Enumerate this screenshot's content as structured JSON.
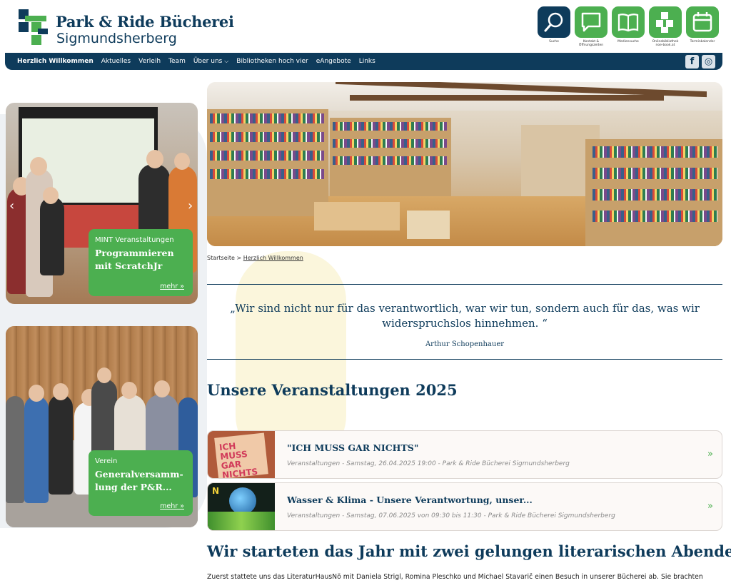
{
  "header": {
    "brand_line1": "Park & Ride Bücherei",
    "brand_line2": "Sigmundsherberg",
    "icon_links": [
      {
        "label": "Suche",
        "icon": "search-icon"
      },
      {
        "label": "Kontakt & Öffnungszeiten",
        "icon": "chat-icon"
      },
      {
        "label": "Mediensuche",
        "icon": "book-icon"
      },
      {
        "label": "Onlinebibliothek noe-book.at",
        "icon": "building-icon"
      },
      {
        "label": "Terminkalender",
        "icon": "calendar-icon"
      }
    ]
  },
  "nav": {
    "items": [
      "Herzlich Willkommen",
      "Aktuelles",
      "Verleih",
      "Team",
      "Über uns",
      "Bibliotheken hoch vier",
      "eAngebote",
      "Links"
    ],
    "dropdown_item_index": 4,
    "social": {
      "facebook": "f",
      "instagram": "◎"
    }
  },
  "sidebar": {
    "cards": [
      {
        "category": "MINT Veranstaltungen",
        "title": "Programmieren mit ScratchJr",
        "more": "mehr »"
      },
      {
        "category": "Verein",
        "title": "Generalversamm-lung der P&R...",
        "more": "mehr »"
      }
    ]
  },
  "breadcrumb": {
    "root": "Startseite",
    "separator": ">",
    "current": "Herzlich Willkommen"
  },
  "quote": {
    "text": "„Wir sind nicht nur für das verantwortlich, war wir tun, sondern auch für das, was wir widerspruchslos hinnehmen. “",
    "author": "Arthur Schopenhauer"
  },
  "events": {
    "heading": "Unsere Veranstaltungen 2025",
    "items": [
      {
        "title": "\"ICH MUSS GAR NICHTS\"",
        "meta": "Veranstaltungen - Samstag, 26.04.2025 19:00 - Park & Ride Bücherei Sigmundsherberg",
        "thumb_text": "ICH MUSS GAR NICHTS"
      },
      {
        "title": "Wasser & Klima - Unsere Verantwortung, unser...",
        "meta": "Veranstaltungen - Samstag, 07.06.2025 von 09:30 bis 11:30 - Park & Ride Bücherei Sigmundsherberg",
        "thumb_text": "N"
      }
    ]
  },
  "article": {
    "heading": "Wir starteten das Jahr mit zwei gelungen literarischen Abenden",
    "paragraph": "Zuerst stattete uns das LiteraturHausNö mit Daniela Strigl, Romina Pleschko und Michael Stavarič einen Besuch in unserer Bücherei ab. Sie brachten"
  },
  "colors": {
    "navy": "#0e3b5b",
    "green": "#4caf50"
  }
}
